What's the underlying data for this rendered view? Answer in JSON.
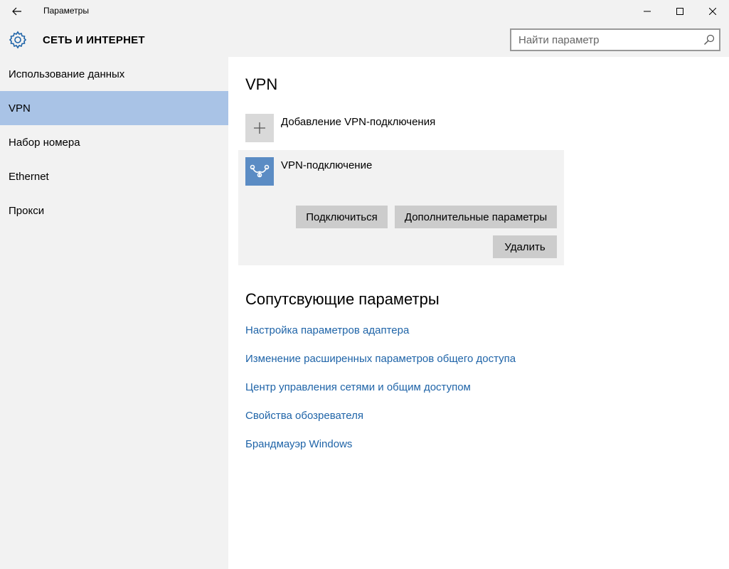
{
  "window": {
    "title": "Параметры"
  },
  "header": {
    "section_title": "СЕТЬ И ИНТЕРНЕТ",
    "search_placeholder": "Найти параметр"
  },
  "sidebar": {
    "items": [
      {
        "label": "Использование данных",
        "selected": false
      },
      {
        "label": "VPN",
        "selected": true
      },
      {
        "label": "Набор номера",
        "selected": false
      },
      {
        "label": "Ethernet",
        "selected": false
      },
      {
        "label": "Прокси",
        "selected": false
      }
    ]
  },
  "main": {
    "title": "VPN",
    "add_label": "Добавление VPN-подключения",
    "connection": {
      "name": "VPN-подключение",
      "connect_label": "Подключиться",
      "advanced_label": "Дополнительные параметры",
      "delete_label": "Удалить"
    },
    "related_title": "Сопутсвующие параметры",
    "related_links": [
      "Настройка параметров адаптера",
      "Изменение расширенных параметров общего доступа",
      "Центр управления сетями и общим доступом",
      "Свойства обозревателя",
      "Брандмауэр Windows"
    ]
  },
  "colors": {
    "accent": "#1f64a8",
    "selected_nav": "#a9c3e6",
    "vpn_icon_bg": "#5b8cc4",
    "button_bg": "#cccccc"
  },
  "icons": {
    "back": "arrow-left-icon",
    "settings": "gear-icon",
    "search": "search-icon",
    "add": "plus-icon",
    "vpn": "vpn-link-icon",
    "minimize": "minimize-icon",
    "maximize": "maximize-icon",
    "close": "close-icon"
  }
}
